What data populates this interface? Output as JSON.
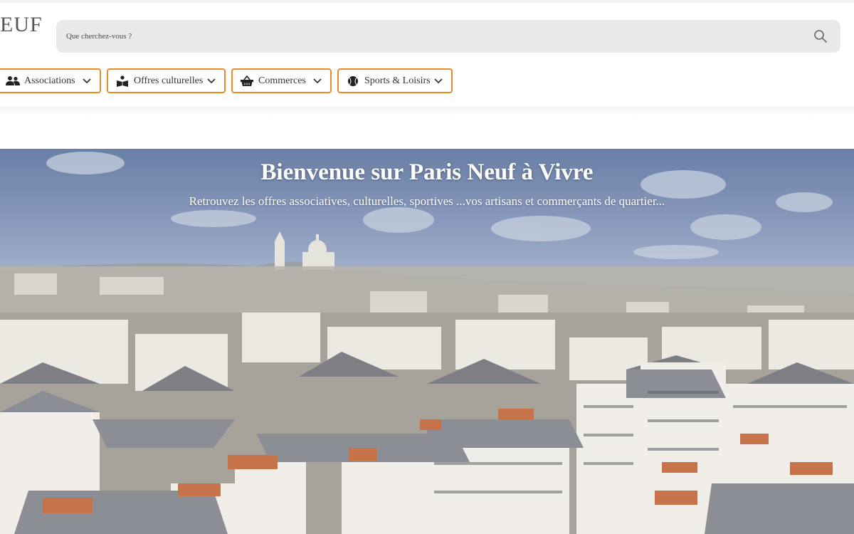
{
  "header": {
    "logo_text": "EUF",
    "search": {
      "placeholder": "Que cherchez-vous ?",
      "icon": "search-icon"
    }
  },
  "categories": [
    {
      "label": "Associations",
      "icon": "users-icon"
    },
    {
      "label": "Offres culturelles",
      "icon": "reading-icon"
    },
    {
      "label": "Commerces",
      "icon": "basket-icon"
    },
    {
      "label": "Sports & Loisirs",
      "icon": "ball-icon"
    }
  ],
  "hero": {
    "title": "Bienvenue sur Paris Neuf à Vivre",
    "subtitle": "Retrouvez les offres associatives, culturelles, sportives ...vos artisans et commerçants de quartier..."
  },
  "colors": {
    "accent": "#ea8a2a",
    "search_bg": "#e9e9e9"
  }
}
